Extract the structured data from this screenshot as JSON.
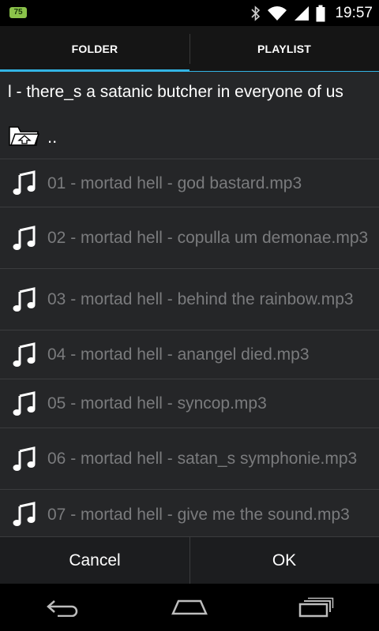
{
  "status_bar": {
    "battery_badge": "75",
    "time": "19:57",
    "icons": [
      "bluetooth-icon",
      "wifi-icon",
      "signal-icon",
      "battery-icon"
    ]
  },
  "tabs": [
    {
      "label": "FOLDER",
      "active": true
    },
    {
      "label": "PLAYLIST",
      "active": false
    }
  ],
  "path": "l - there_s a satanic butcher in everyone of us",
  "parent": {
    "label": ".."
  },
  "files": [
    {
      "name": "01 - mortad hell - god bastard.mp3"
    },
    {
      "name": "02 - mortad hell - copulla um demonae.mp3"
    },
    {
      "name": "03 - mortad hell - behind the rainbow.mp3"
    },
    {
      "name": "04 - mortad hell - anangel died.mp3"
    },
    {
      "name": "05 - mortad hell - syncop.mp3"
    },
    {
      "name": "06 - mortad hell - satan_s symphonie.mp3"
    },
    {
      "name": "07 - mortad hell - give me the sound.mp3"
    }
  ],
  "buttons": {
    "cancel": "Cancel",
    "ok": "OK"
  },
  "colors": {
    "accent": "#33b5e5",
    "dialog_bg": "#252628",
    "file_text": "#7a7b7d"
  }
}
